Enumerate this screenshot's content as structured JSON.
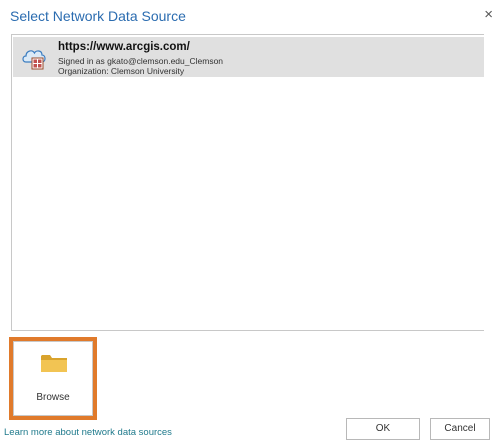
{
  "dialog": {
    "title": "Select Network Data Source",
    "close_glyph": "×"
  },
  "sources": [
    {
      "url": "https://www.arcgis.com/",
      "signed_in": "Signed in as gkato@clemson.edu_Clemson",
      "organization": "Organization: Clemson University",
      "icon": "cloud-portal-icon",
      "selected": true
    }
  ],
  "browse": {
    "label": "Browse",
    "icon": "folder-icon"
  },
  "footer": {
    "learn_more": "Learn more about network data sources",
    "ok_label": "OK",
    "cancel_label": "Cancel"
  },
  "colors": {
    "title": "#2b6cb0",
    "highlight": "#e07a2b",
    "selected_row": "#e0e0e0",
    "link": "#1f7a8c",
    "folder": "#e8b53c"
  }
}
